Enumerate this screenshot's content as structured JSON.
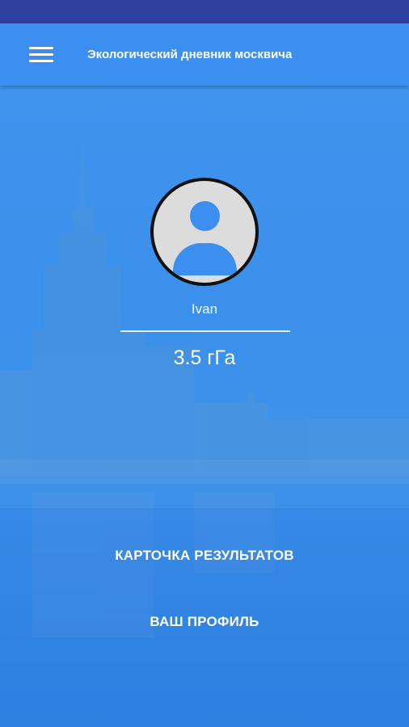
{
  "toolbar": {
    "menu_icon": "hamburger-menu-icon",
    "title": "Экологический дневник москвича"
  },
  "profile": {
    "avatar_icon": "person-icon",
    "username": "Ivan",
    "score": "3.5 гГа"
  },
  "actions": {
    "results_card_label": "КАРТОЧКА РЕЗУЛЬТАТОВ",
    "profile_label": "ВАШ ПРОФИЛЬ"
  },
  "colors": {
    "status_bar": "#2d3f9f",
    "toolbar": "#3a8ff0",
    "accent_blue": "#3a8ff0",
    "avatar_bg": "#dcdcdc"
  }
}
